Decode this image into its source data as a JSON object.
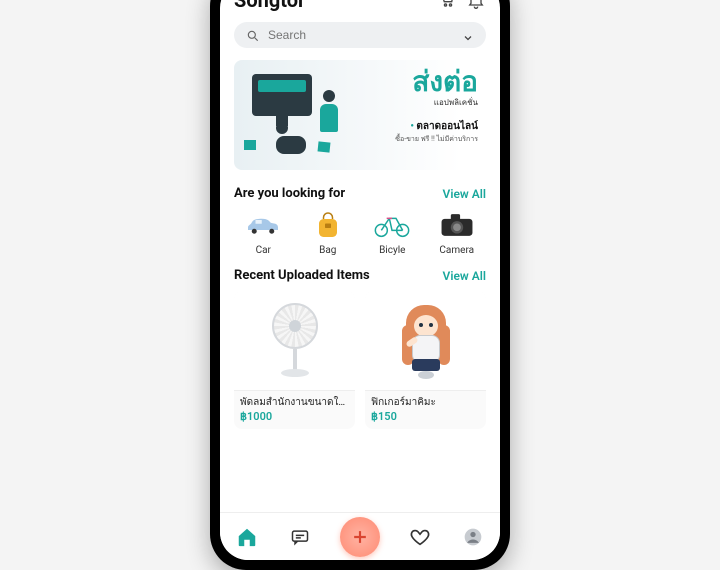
{
  "header": {
    "title": "Songtor"
  },
  "search": {
    "placeholder": "Search"
  },
  "banner": {
    "thai_big": "ส่งต่อ",
    "thai_sub": "แอปพลิเคชั่น",
    "line2": "ตลาดออนไลน์",
    "line3": "ซื้อ-ขาย ฟรี !! ไม่มีค่าบริการ"
  },
  "categories": {
    "title": "Are you looking for",
    "view_all": "View All",
    "items": [
      {
        "label": "Car"
      },
      {
        "label": "Bag"
      },
      {
        "label": "Bicyle"
      },
      {
        "label": "Camera"
      }
    ]
  },
  "recent": {
    "title": "Recent Uploaded Items",
    "view_all": "View All",
    "items": [
      {
        "name": "พัดลมสำนักงานขนาดใหญ่",
        "price": "฿1000"
      },
      {
        "name": "ฟิกเกอร์มาคิมะ",
        "price": "฿150"
      }
    ]
  },
  "colors": {
    "accent": "#1aa79c",
    "add_btn": "#ff8a72"
  }
}
